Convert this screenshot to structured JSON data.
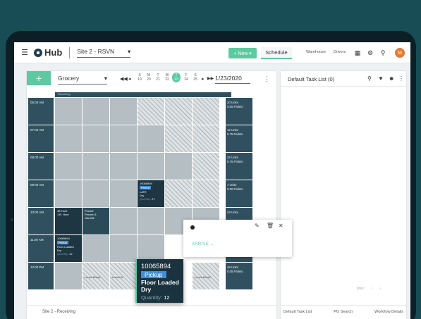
{
  "app": {
    "logo": "Hub",
    "site": "Site 2 - RSVN",
    "new_label": "+ New ▾",
    "schedule_label": "Schedule",
    "links": [
      "Warehouse",
      "Drivers"
    ],
    "avatar_initial": "M",
    "accent": "#5cc9a1"
  },
  "toolbar": {
    "add": "+",
    "category": "Grocery",
    "days": [
      {
        "dow": "S",
        "num": "19"
      },
      {
        "dow": "M",
        "num": "20"
      },
      {
        "dow": "T",
        "num": "21"
      },
      {
        "dow": "W",
        "num": "22"
      },
      {
        "dow": "T",
        "num": "23"
      },
      {
        "dow": "F",
        "num": "24"
      },
      {
        "dow": "S",
        "num": "25"
      }
    ],
    "date": "1/23/2020"
  },
  "schedule": {
    "dock": "Receiving",
    "times": [
      "05:00 AM",
      "07:00 AM",
      "08:00 AM",
      "09:00 AM",
      "10:00 AM",
      "11:00 AM",
      "12:00 PM"
    ],
    "stats": [
      {
        "units": "30 Units",
        "pallets": "0.05 Pallets"
      },
      {
        "units": "12 Units",
        "pallets": "0.75 Pallets"
      },
      {
        "units": "24 Units",
        "pallets": "0.75 Pallets"
      },
      {
        "units": "7 Units",
        "pallets": "0.00 Pallets"
      },
      {
        "units": "24 Units",
        "pallets": ""
      },
      {
        "units": "",
        "pallets": ""
      },
      {
        "units": "49 Units",
        "pallets": "0.05 Pallets"
      }
    ],
    "task_late": {
      "id": "10065894",
      "type": "Pickup",
      "status": "LATE",
      "kind": "Dry",
      "qty_label": "Quantity:",
      "qty": "27"
    },
    "task_jb": {
      "line1": "JB Hunt",
      "line2": "J.B. Hunt"
    },
    "task_pg": {
      "line1": "Procter",
      "line2": "Procter &",
      "line3": "Gamble"
    },
    "task_small": {
      "id": "10065894",
      "type": "Pickup",
      "kind": "Floor Loaded",
      "kind2": "Dry",
      "qty_label": "Quantity:",
      "qty": "12"
    },
    "lunch": [
      "Lunch Break",
      "Lunch Br",
      "Lunch Break"
    ],
    "footer": "Site 2 - Receiving"
  },
  "card": {
    "id": "10065894",
    "type": "Pickup",
    "kind": "Floor Loaded",
    "kind2": "Dry",
    "qty_label": "Quantity:",
    "qty": "12"
  },
  "popup": {
    "action": "ARRIVE"
  },
  "tasklist": {
    "title": "Default Task List (0)",
    "pager": "prev",
    "tabs": [
      "Default Task List",
      "PO Search",
      "Workflow Details"
    ]
  }
}
